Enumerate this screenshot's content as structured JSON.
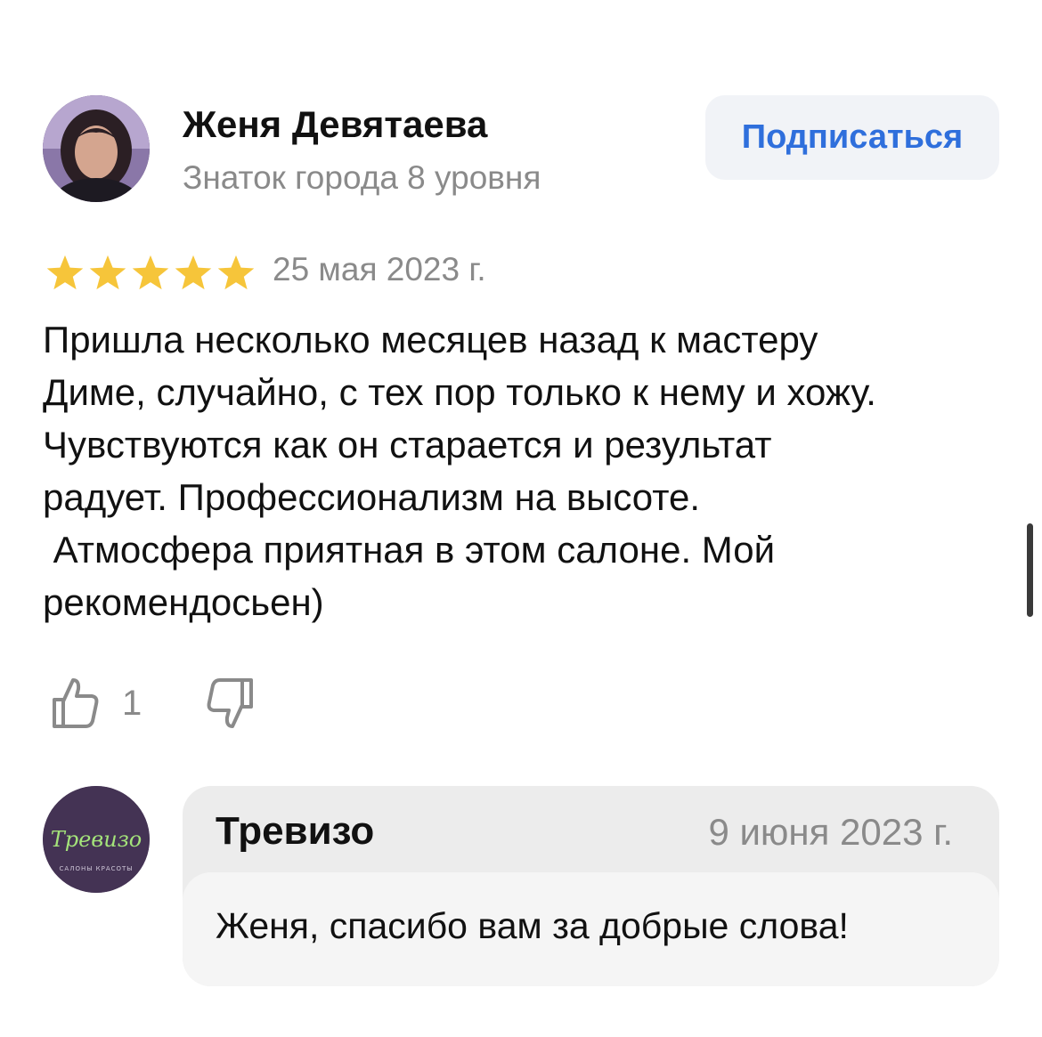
{
  "review": {
    "author": {
      "name": "Женя Девятаева",
      "level": "Знаток города 8 уровня",
      "avatar_icon": "user-photo"
    },
    "subscribe_label": "Подписаться",
    "rating": 5,
    "rating_max": 5,
    "date": "25 мая 2023 г.",
    "text_lines": [
      "Пришла несколько месяцев назад к мастеру",
      "Диме, случайно, с тех пор только к нему и хожу.",
      "Чувствуются как он старается и результат",
      "радует. Профессионализм на высоте.",
      " Атмосфера приятная в этом салоне. Мой",
      "рекомендосьен)"
    ],
    "likes": "1",
    "like_icon": "thumbs-up-icon",
    "dislike_icon": "thumbs-down-icon"
  },
  "reply": {
    "org_name": "Тревизо",
    "date": "9 июня 2023 г.",
    "text": "Женя, спасибо вам за добрые слова!",
    "logo": {
      "script": "Тревизо",
      "tagline": "САЛОНЫ КРАСОТЫ"
    }
  },
  "colors": {
    "accent": "#2f6fdc",
    "star": "#f6c53a",
    "muted": "#8a8a8a",
    "logo_bg": "#443354",
    "logo_text": "#a4e37a"
  }
}
